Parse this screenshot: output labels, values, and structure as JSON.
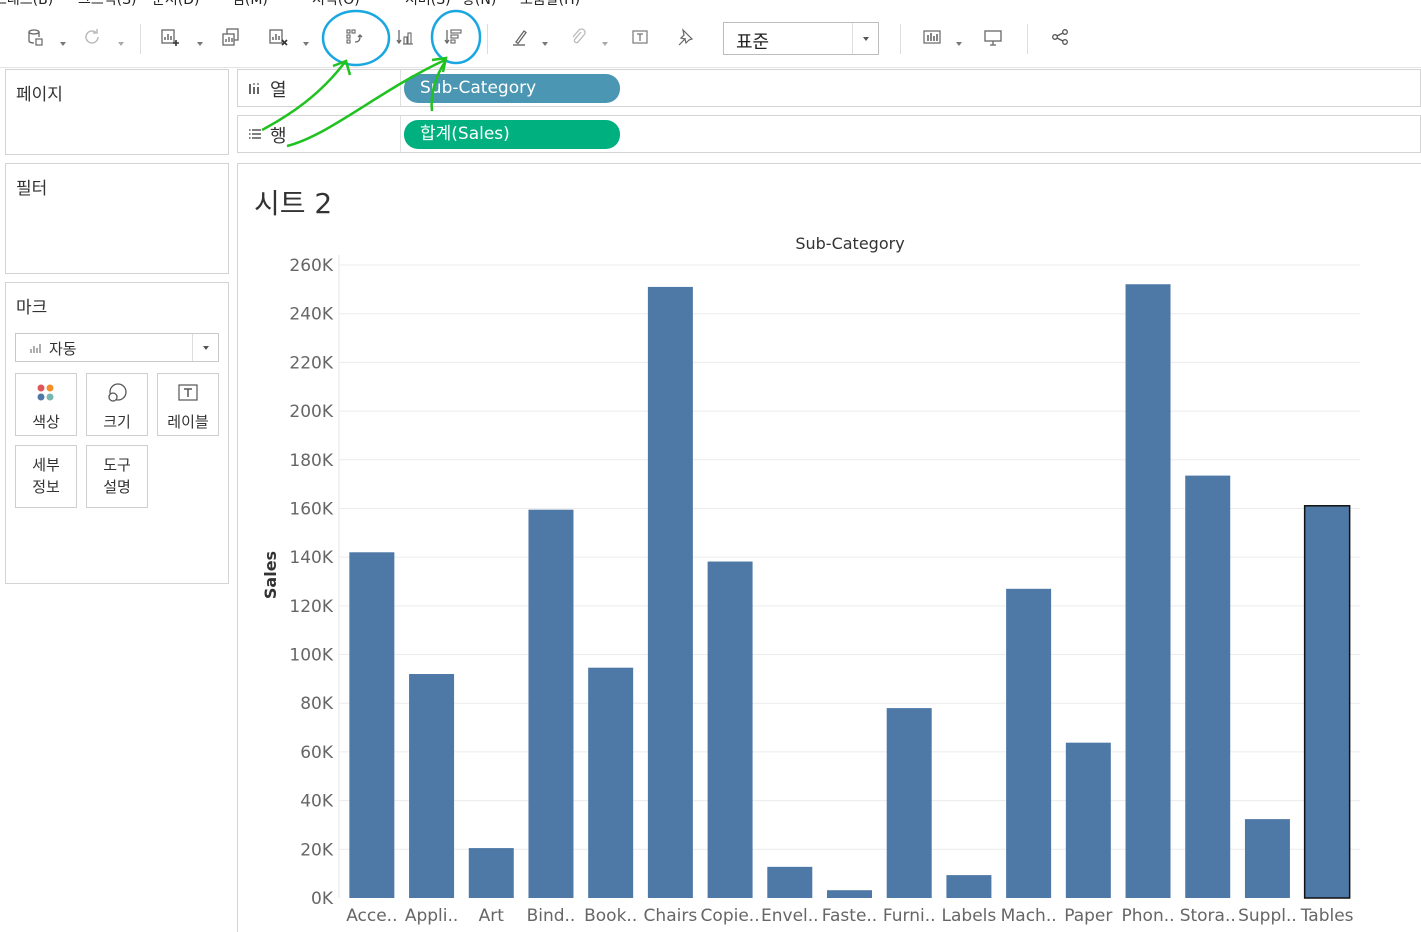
{
  "menu": {
    "items": [
      "트래스(B)",
      "그프식(S)",
      "문서(D)",
      "검(M)",
      "서식(O)",
      "서버(S)",
      "창(N)",
      "도움말(H)"
    ]
  },
  "toolbar": {
    "icons": [
      "data-source-icon",
      "refresh-icon",
      "new-sheet-icon",
      "duplicate-sheet-icon",
      "clear-sheet-icon",
      "swap-rows-columns-icon",
      "sort-ascending-icon",
      "sort-descending-icon",
      "highlight-icon",
      "group-icon",
      "label-icon",
      "pin-icon",
      "show-cards-icon",
      "presentation-icon",
      "share-icon"
    ],
    "fit_value": "표준"
  },
  "panels": {
    "pages_title": "페이지",
    "filters_title": "필터",
    "marks_title": "마크",
    "mark_type": "자동",
    "cards": {
      "color": "색상",
      "size": "크기",
      "label": "레이블",
      "detail_1": "세부",
      "detail_2": "정보",
      "tooltip_1": "도구",
      "tooltip_2": "설명"
    }
  },
  "shelves": {
    "columns_label": "열",
    "rows_label": "행",
    "columns_pill": "Sub-Category",
    "rows_pill": "합계(Sales)",
    "columns_pill_color": "#4a96b3",
    "rows_pill_color": "#00b07f"
  },
  "sheet": {
    "title": "시트 2"
  },
  "chart_data": {
    "type": "bar",
    "title": "Sub-Category",
    "xlabel": "",
    "ylabel": "Sales",
    "ylim": [
      0,
      260000
    ],
    "y_ticks": [
      "0K",
      "20K",
      "40K",
      "60K",
      "80K",
      "100K",
      "120K",
      "140K",
      "160K",
      "180K",
      "200K",
      "220K",
      "240K",
      "260K"
    ],
    "y_tick_values": [
      0,
      20000,
      40000,
      60000,
      80000,
      100000,
      120000,
      140000,
      160000,
      180000,
      200000,
      220000,
      240000,
      260000
    ],
    "categories": [
      "Acce..",
      "Appli..",
      "Art",
      "Bind..",
      "Book..",
      "Chairs",
      "Copie..",
      "Envel..",
      "Faste..",
      "Furni..",
      "Labels",
      "Mach..",
      "Paper",
      "Phon..",
      "Stora..",
      "Suppl..",
      "Tables"
    ],
    "values": [
      142000,
      92000,
      20500,
      159500,
      94600,
      251000,
      138200,
      12800,
      3200,
      78000,
      9400,
      127000,
      63800,
      252100,
      173500,
      32400,
      161100
    ],
    "bar_color": "#4e79a7",
    "selected_index": 16,
    "grid": true
  },
  "annotations": {
    "circle_color": "#1aa7e0",
    "arrow_color": "#1fc21f"
  }
}
